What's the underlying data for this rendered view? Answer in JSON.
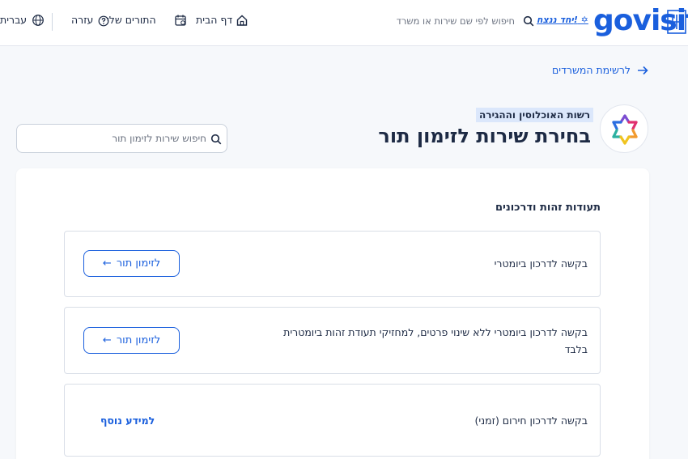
{
  "header": {
    "logo_text": "govisit",
    "slogan": "יחד ננצח!",
    "search_placeholder": "חיפוש לפי שם שירות או משרד",
    "nav": {
      "home": "דף הבית",
      "my_appointments": "התורים שלי",
      "help": "עזרה",
      "language": "עברית"
    }
  },
  "breadcrumb": {
    "back": "לרשימת המשרדים"
  },
  "ministry": {
    "name": "רשות האוכלוסין וההגירה"
  },
  "page": {
    "title": "בחירת שירות לזימון תור"
  },
  "service_search": {
    "placeholder": "חיפוש שירות לזימון תור"
  },
  "section": {
    "title": "תעודות זהות ודרכונים",
    "services": [
      {
        "label": "בקשה לדרכון ביומטרי",
        "action": "לזימון תור"
      },
      {
        "label_line1": "בקשה לדרכון ביומטרי ללא שינוי פרטים, למחזיקי תעודת זהות ביומטרית",
        "label_line2": "בלבד",
        "action": "לזימון תור"
      },
      {
        "label": "בקשה לדרכון חירום (זמני)",
        "action": "למידע נוסף"
      }
    ]
  },
  "colors": {
    "brand": "#1a5fdd",
    "text": "#1d2a44",
    "tag_bg": "#dbe7fb",
    "page_bg": "#f6f8fb"
  }
}
